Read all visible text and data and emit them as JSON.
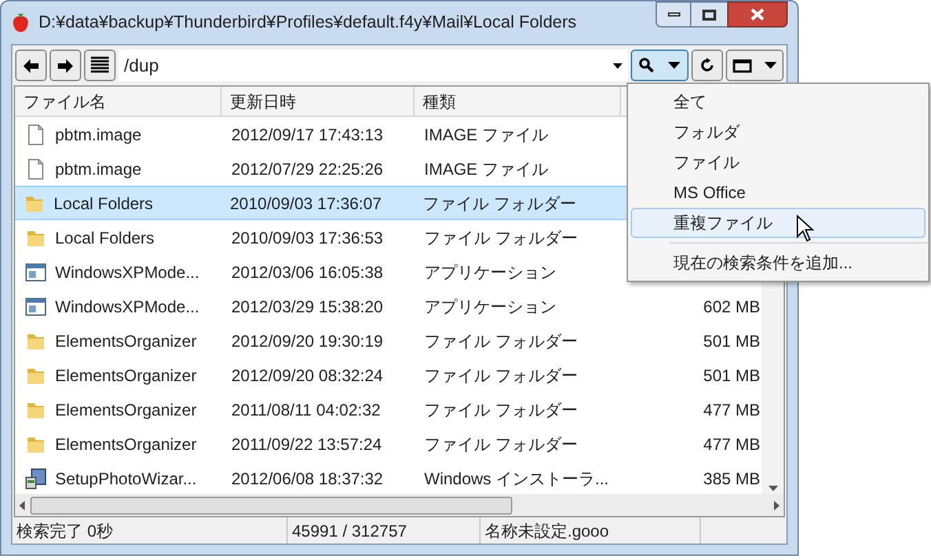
{
  "window": {
    "title": "D:¥data¥backup¥Thunderbird¥Profiles¥default.f4y¥Mail¥Local Folders"
  },
  "toolbar": {
    "path": {
      "value": "/dup"
    }
  },
  "table": {
    "columns": [
      "ファイル名",
      "更新日時",
      "種類"
    ],
    "rows": [
      {
        "kind": "file",
        "name": "pbtm.image",
        "modified": "2012/09/17 17:43:13",
        "type": "IMAGE ファイル",
        "selected": false
      },
      {
        "kind": "file",
        "name": "pbtm.image",
        "modified": "2012/07/29 22:25:26",
        "type": "IMAGE ファイル",
        "selected": false
      },
      {
        "kind": "folder",
        "name": "Local Folders",
        "modified": "2010/09/03 17:36:07",
        "type": "ファイル フォルダー",
        "selected": true
      },
      {
        "kind": "folder",
        "name": "Local Folders",
        "modified": "2010/09/03 17:36:53",
        "type": "ファイル フォルダー",
        "selected": false
      },
      {
        "kind": "app",
        "name": "WindowsXPMode...",
        "modified": "2012/03/06 16:05:38",
        "type": "アプリケーション",
        "selected": false
      },
      {
        "kind": "app",
        "name": "WindowsXPMode...",
        "modified": "2012/03/29 15:38:20",
        "type": "アプリケーション",
        "size": "602 MB",
        "selected": false
      },
      {
        "kind": "folder",
        "name": "ElementsOrganizer",
        "modified": "2012/09/20 19:30:19",
        "type": "ファイル フォルダー",
        "size": "501 MB",
        "selected": false
      },
      {
        "kind": "folder",
        "name": "ElementsOrganizer",
        "modified": "2012/09/20 08:32:24",
        "type": "ファイル フォルダー",
        "size": "501 MB",
        "selected": false
      },
      {
        "kind": "folder",
        "name": "ElementsOrganizer",
        "modified": "2011/08/11 04:02:32",
        "type": "ファイル フォルダー",
        "size": "477 MB",
        "selected": false
      },
      {
        "kind": "folder",
        "name": "ElementsOrganizer",
        "modified": "2011/09/22 13:57:24",
        "type": "ファイル フォルダー",
        "size": "477 MB",
        "selected": false
      },
      {
        "kind": "installer",
        "name": "SetupPhotoWizar...",
        "modified": "2012/06/08 18:37:32",
        "type": "Windows インストーラ...",
        "size": "385 MB",
        "selected": false
      }
    ]
  },
  "status_bar": [
    "検索完了 0秒",
    "45991 / 312757",
    "名称未設定.gooo"
  ],
  "menu": {
    "items": [
      {
        "kind": "item",
        "label": "全て",
        "selected": false
      },
      {
        "kind": "item",
        "label": "フォルダ",
        "selected": false
      },
      {
        "kind": "item",
        "label": "ファイル",
        "selected": false
      },
      {
        "kind": "item",
        "label": "MS Office",
        "selected": false
      },
      {
        "kind": "item",
        "label": "重複ファイル",
        "selected": true
      },
      {
        "kind": "separator"
      },
      {
        "kind": "item",
        "label": "現在の検索条件を追加...",
        "selected": false
      }
    ]
  }
}
